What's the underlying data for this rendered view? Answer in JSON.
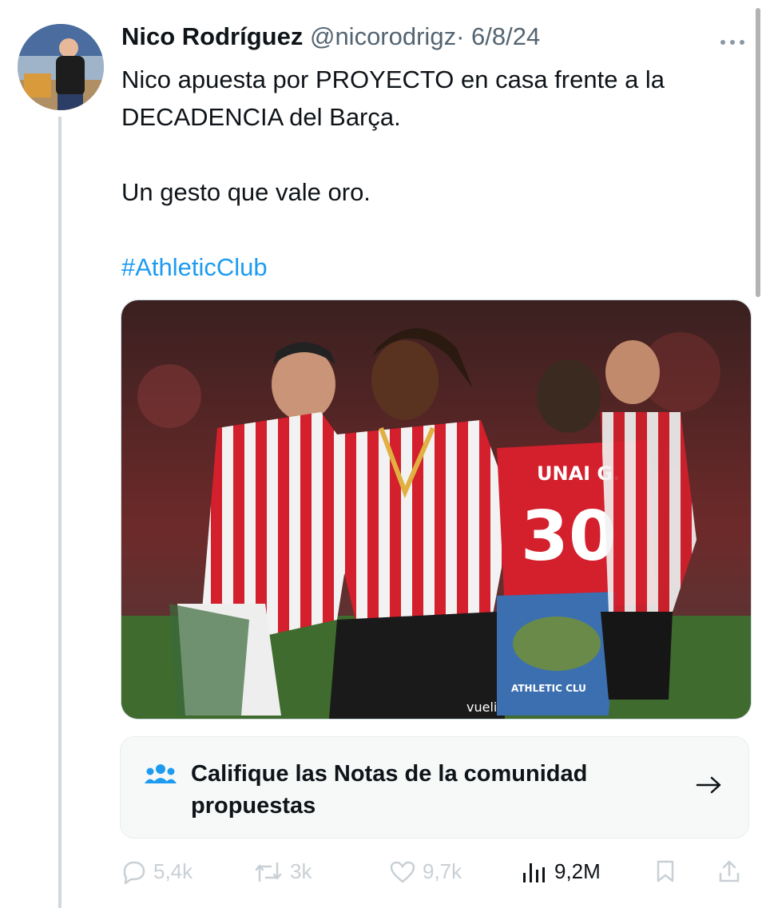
{
  "tweet": {
    "author_name": "Nico Rodríguez",
    "handle": "@nicorodrigz",
    "separator": "·",
    "date": "6/8/24",
    "more_icon": "more-horizontal-icon",
    "text_lines": [
      "Nico apuesta por PROYECTO en casa frente a la DECADENCIA del Barça.",
      "Un gesto que vale oro."
    ],
    "hashtag": "#AthleticClub",
    "photo": {
      "jersey_name": "UNAI G.",
      "jersey_number": "30",
      "flag_text": "ATHLETIC CLU",
      "shorts_sponsor": "vueling"
    }
  },
  "community_notes": {
    "icon": "people-icon",
    "label": "Califique las Notas de la comunidad propuestas",
    "arrow_icon": "arrow-right-icon"
  },
  "actions": {
    "replies": "5,4k",
    "reposts": "3k",
    "likes": "9,7k",
    "views": "9,2M"
  },
  "colors": {
    "text": "#0f1419",
    "secondary": "#536471",
    "link": "#1d9bf0",
    "faded_action": "#c9d0d5",
    "thread_line": "#cfd9de",
    "notes_bg": "#f7f9f9"
  }
}
